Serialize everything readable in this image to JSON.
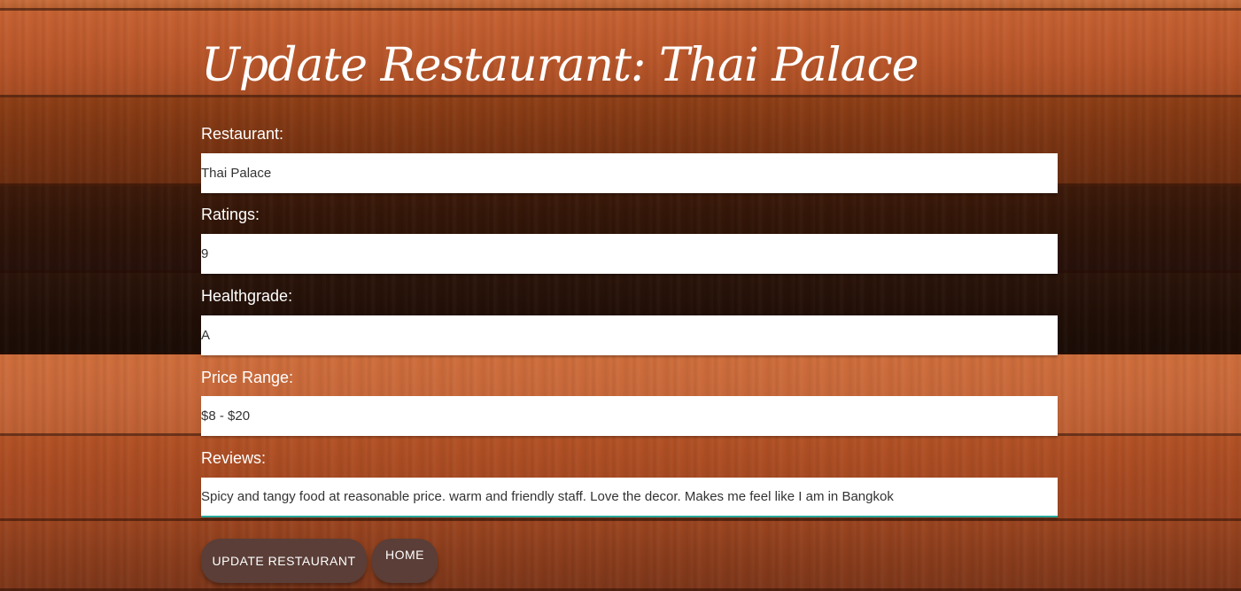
{
  "page": {
    "title": "Update Restaurant: Thai Palace"
  },
  "form": {
    "restaurant": {
      "label": "Restaurant:",
      "value": "Thai Palace"
    },
    "ratings": {
      "label": "Ratings:",
      "value": "9"
    },
    "healthgrade": {
      "label": "Healthgrade:",
      "value": "A"
    },
    "price_range": {
      "label": "Price Range:",
      "value": "$8 - $20"
    },
    "reviews": {
      "label": "Reviews:",
      "value": "Spicy and tangy food at reasonable price. warm and friendly staff. Love the decor. Makes me feel like I am in Bangkok"
    }
  },
  "buttons": {
    "update_label": "Update Restaurant",
    "home_label": "Home"
  },
  "colors": {
    "button_bg": "#5a3e37",
    "focus_underline": "#26a69a",
    "text_on_wood": "#ffffff"
  }
}
